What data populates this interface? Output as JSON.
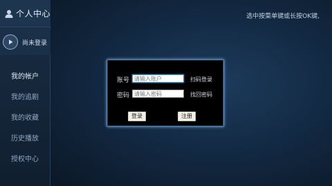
{
  "sidebar": {
    "title": "个人中心",
    "user": {
      "status": "尚未登录"
    },
    "items": [
      {
        "label": "我的帐户",
        "active": true
      },
      {
        "label": "我的追剧",
        "active": false
      },
      {
        "label": "我的收藏",
        "active": false
      },
      {
        "label": "历史播放",
        "active": false
      },
      {
        "label": "授权中心",
        "active": false
      }
    ]
  },
  "main": {
    "hint": "选中按菜单键或长按OK键,",
    "empty_text": "~"
  },
  "login_dialog": {
    "account_label": "账号",
    "account_placeholder": "请输入账户",
    "account_link": "扫码登录",
    "password_label": "密码",
    "password_placeholder": "请输入密码",
    "password_link": "找回密码",
    "login_button": "登录",
    "register_button": "注册"
  },
  "colors": {
    "accent_border": "#5b86b3",
    "background": "#0d1a2a"
  }
}
